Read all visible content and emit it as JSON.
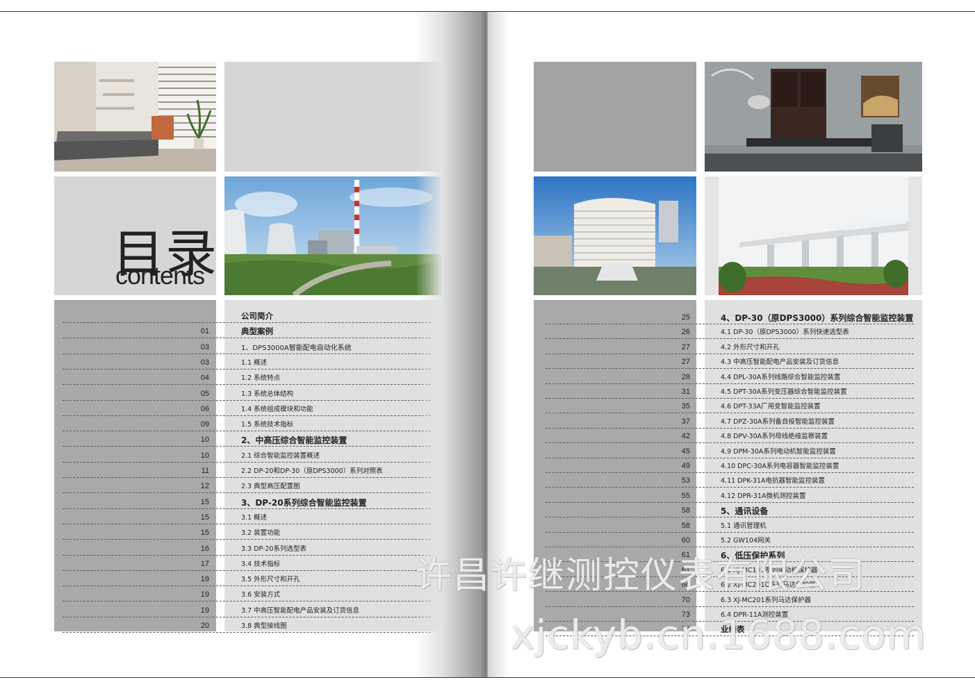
{
  "title": {
    "cn": "目录",
    "en": "contents"
  },
  "left_toc": [
    {
      "num": "",
      "text": "公司简介",
      "style": "head"
    },
    {
      "num": "01",
      "text": "典型案例",
      "style": "head"
    },
    {
      "num": "03",
      "text": "1、DPS3000A智能配电自动化系统",
      "style": "item"
    },
    {
      "num": "03",
      "text": "1.1   概述",
      "style": "sub"
    },
    {
      "num": "04",
      "text": "1.2   系统特点",
      "style": "sub"
    },
    {
      "num": "05",
      "text": "1.3   系统总体结构",
      "style": "sub"
    },
    {
      "num": "06",
      "text": "1.4   系统组成模块和功能",
      "style": "sub"
    },
    {
      "num": "09",
      "text": "1.5   系统技术指标",
      "style": "sub"
    },
    {
      "num": "10",
      "text": "2、中高压综合智能监控装置",
      "style": "major"
    },
    {
      "num": "10",
      "text": "2.1   综合智能监控装置概述",
      "style": "sub"
    },
    {
      "num": "11",
      "text": "2.2   DP-20和DP-30（原DPS3000）系列对照表",
      "style": "sub"
    },
    {
      "num": "12",
      "text": "2.3   典型高压配置图",
      "style": "sub"
    },
    {
      "num": "15",
      "text": "3、DP-20系列综合智能监控装置",
      "style": "major"
    },
    {
      "num": "15",
      "text": "3.1   概述",
      "style": "sub"
    },
    {
      "num": "15",
      "text": "3.2   装置功能",
      "style": "sub"
    },
    {
      "num": "16",
      "text": "3.3   DP-20系列选型表",
      "style": "sub"
    },
    {
      "num": "17",
      "text": "3.4   技术指标",
      "style": "sub"
    },
    {
      "num": "19",
      "text": "3.5   外形尺寸和开孔",
      "style": "sub"
    },
    {
      "num": "19",
      "text": "3.6   安装方式",
      "style": "sub"
    },
    {
      "num": "19",
      "text": "3.7   中高压智能配电产品安装及订货信息",
      "style": "sub"
    },
    {
      "num": "20",
      "text": "3.8   典型接线图",
      "style": "sub"
    }
  ],
  "right_toc": [
    {
      "num": "25",
      "text": "4、DP-30（原DPS3000）系列综合智能监控装置",
      "style": "major"
    },
    {
      "num": "26",
      "text": "4.1   DP-30（原DPS3000）系列快速选型表",
      "style": "sub"
    },
    {
      "num": "27",
      "text": "4.2   外形尺寸和开孔",
      "style": "sub"
    },
    {
      "num": "27",
      "text": "4.3   中高压智能配电产品安装及订货信息",
      "style": "sub"
    },
    {
      "num": "28",
      "text": "4.4   DPL-30A系列线路综合智能监控装置",
      "style": "sub"
    },
    {
      "num": "31",
      "text": "4.5   DPT-30A系列变压器综合智能监控装置",
      "style": "sub"
    },
    {
      "num": "35",
      "text": "4.6   DPT-33A厂用变智能监控装置",
      "style": "sub"
    },
    {
      "num": "37",
      "text": "4.7   DPZ-30A系列备自投智能监控装置",
      "style": "sub"
    },
    {
      "num": "42",
      "text": "4.8   DPV-30A系列母线绝缘监察装置",
      "style": "sub"
    },
    {
      "num": "45",
      "text": "4.9   DPM-30A系列电动机智能监控装置",
      "style": "sub"
    },
    {
      "num": "49",
      "text": "4.10   DPC-30A系列电容器智能监控装置",
      "style": "sub"
    },
    {
      "num": "53",
      "text": "4.11   DPK-31A电抗器智能监控装置",
      "style": "sub"
    },
    {
      "num": "55",
      "text": "4.12   DPR-31A微机测控装置",
      "style": "sub"
    },
    {
      "num": "58",
      "text": "5、通讯设备",
      "style": "major"
    },
    {
      "num": "58",
      "text": "5.1   通讯管理机",
      "style": "sub"
    },
    {
      "num": "60",
      "text": "5.2   GW104网关",
      "style": "sub"
    },
    {
      "num": "61",
      "text": "6、低压保护系列",
      "style": "major"
    },
    {
      "num": "61",
      "text": "6.1   XJ-MC101系列电动机保护器",
      "style": "sub"
    },
    {
      "num": "66",
      "text": "6.2   XJ-MC201C系列马达保护器",
      "style": "sub"
    },
    {
      "num": "70",
      "text": "6.3   XJ-MC201系列马达保护器",
      "style": "sub"
    },
    {
      "num": "73",
      "text": "6.4   DPR-11A测控装置",
      "style": "sub"
    },
    {
      "num": "76",
      "text": "业绩表",
      "style": "head"
    }
  ],
  "watermark": {
    "line1": "许昌许继测控仪表有限公司",
    "line2": "xjckyb.cn.1688.com"
  },
  "photos": {
    "living_room": "living-room-photo",
    "power_plant": "power-plant-photo",
    "office": "office-photo",
    "hospital": "hospital-building-photo",
    "railway": "railway-viaduct-photo"
  },
  "colors": {
    "light_gray": "#d6d6d6",
    "mid_gray": "#a9a9a9",
    "toc_gray": "#e0e0e0"
  }
}
